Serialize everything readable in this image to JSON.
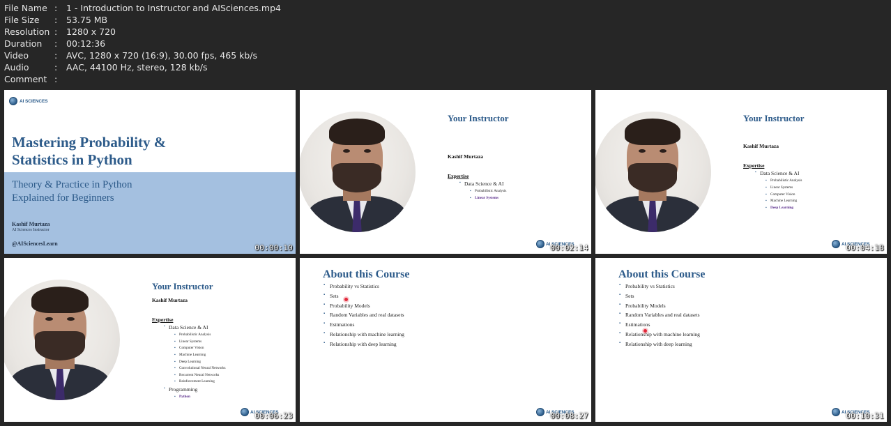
{
  "info": {
    "separator": ":",
    "rows": [
      {
        "key": "File Name",
        "value": "1 - Introduction to Instructor and AISciences.mp4"
      },
      {
        "key": "File Size",
        "value": "53.75 MB"
      },
      {
        "key": "Resolution",
        "value": "1280 x 720"
      },
      {
        "key": "Duration",
        "value": "00:12:36"
      },
      {
        "key": "Video",
        "value": "AVC, 1280 x 720 (16:9), 30.00 fps, 465 kb/s"
      },
      {
        "key": "Audio",
        "value": "AAC, 44100 Hz, stereo, 128 kb/s"
      },
      {
        "key": "Comment",
        "value": ""
      }
    ]
  },
  "brand": {
    "logo_text": "AI SCIENCES"
  },
  "thumbnails": [
    {
      "timestamp": "00:00:10",
      "title_line1": "Mastering Probability &",
      "title_line2": "Statistics in Python",
      "subtitle_line1": "Theory & Practice in Python",
      "subtitle_line2": "Explained for Beginners",
      "name": "Kashif Murtaza",
      "role": "AI Sciences Instructor",
      "handle": "@AISciencesLearn"
    },
    {
      "timestamp": "00:02:14",
      "title": "Your Instructor",
      "name": "Kashif Murtaza",
      "expertise": "Expertise",
      "area": "Data Science & AI",
      "items": [
        "Probabilistic Analysis",
        "Linear Systems"
      ]
    },
    {
      "timestamp": "00:04:18",
      "title": "Your Instructor",
      "name": "Kashif Murtaza",
      "expertise": "Expertise",
      "area": "Data Science & AI",
      "items": [
        "Probabilistic Analysis",
        "Linear Systems",
        "Computer Vision",
        "Machine Learning",
        "Deep Learning"
      ]
    },
    {
      "timestamp": "00:06:23",
      "title": "Your Instructor",
      "name": "Kashif Murtaza",
      "expertise": "Expertise",
      "area": "Data Science & AI",
      "items": [
        "Probabilistic Analysis",
        "Linear Systems",
        "Computer Vision",
        "Machine Learning",
        "Deep Learning",
        "Convolutional Neural Networks",
        "Recurrent Neural Networks",
        "Reinforcement Learning"
      ],
      "area2": "Programming",
      "items2": [
        "Python"
      ]
    },
    {
      "timestamp": "00:08:27",
      "title": "About this Course",
      "items": [
        "Probability vs Statistics",
        "Sets",
        "Probability Models",
        "Random Variables and real datasets",
        "Estimations",
        "Relationship with machine learning",
        "Relationship with deep learning"
      ]
    },
    {
      "timestamp": "00:10:31",
      "title": "About this Course",
      "items": [
        "Probability vs Statistics",
        "Sets",
        "Probability Models",
        "Random Variables and real datasets",
        "Estimations",
        "Relationship with machine learning",
        "Relationship with deep learning"
      ]
    }
  ]
}
